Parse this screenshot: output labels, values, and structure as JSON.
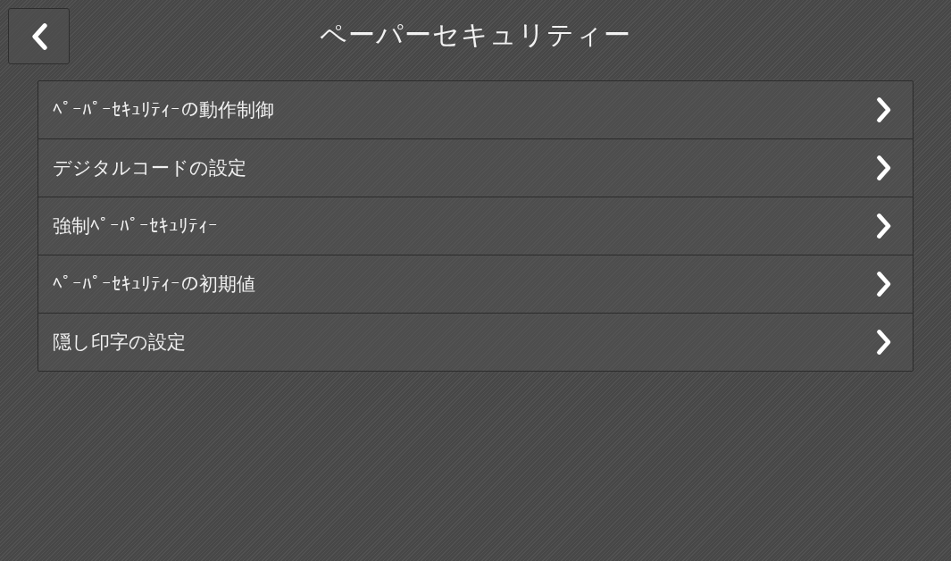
{
  "header": {
    "title": "ペーパーセキュリティー"
  },
  "menu_items": [
    {
      "label": "ﾍﾟｰﾊﾟｰｾｷｭﾘﾃｨｰの動作制御"
    },
    {
      "label": "デジタルコードの設定"
    },
    {
      "label": "強制ﾍﾟｰﾊﾟｰｾｷｭﾘﾃｨｰ"
    },
    {
      "label": "ﾍﾟｰﾊﾟｰｾｷｭﾘﾃｨｰの初期値"
    },
    {
      "label": "隠し印字の設定"
    }
  ]
}
